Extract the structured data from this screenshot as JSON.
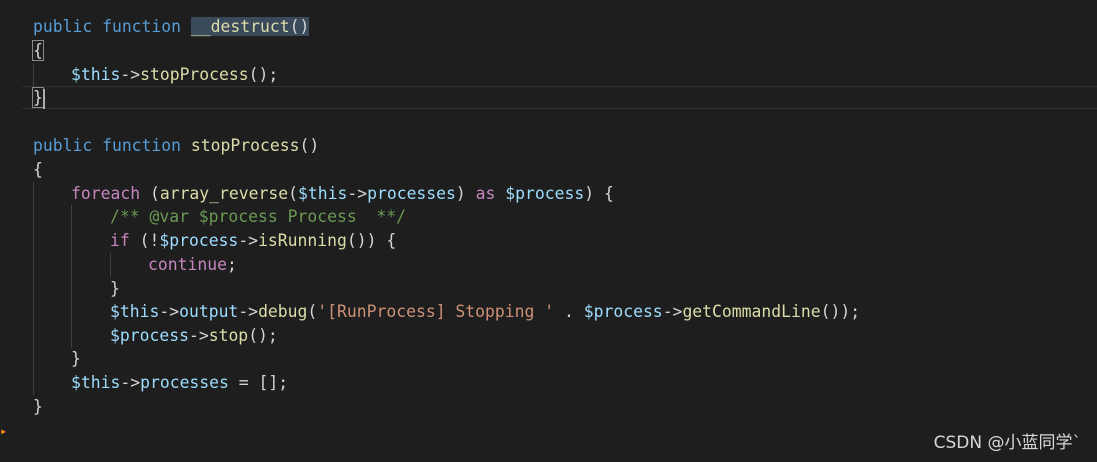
{
  "editor": {
    "language": "php",
    "lines": [
      {
        "id": "l1",
        "tokens": [
          {
            "t": "public ",
            "k": "kw"
          },
          {
            "t": "function ",
            "k": "kw"
          },
          {
            "t": "__destruct",
            "k": "fn",
            "hl": true
          },
          {
            "t": "()",
            "k": "",
            "hl": true
          }
        ]
      },
      {
        "id": "l2",
        "tokens": [
          {
            "t": "{",
            "k": "",
            "match": true
          }
        ]
      },
      {
        "id": "l3",
        "tokens": [
          {
            "t": "$this",
            "k": "var"
          },
          {
            "t": "->",
            "k": ""
          },
          {
            "t": "stopProcess",
            "k": "fn"
          },
          {
            "t": "();",
            "k": ""
          }
        ]
      },
      {
        "id": "l4",
        "tokens": [
          {
            "t": "}",
            "k": "",
            "match": true
          }
        ]
      },
      {
        "id": "l5",
        "tokens": []
      },
      {
        "id": "l6",
        "tokens": [
          {
            "t": "public ",
            "k": "kw"
          },
          {
            "t": "function ",
            "k": "kw"
          },
          {
            "t": "stopProcess",
            "k": "fn"
          },
          {
            "t": "()",
            "k": ""
          }
        ]
      },
      {
        "id": "l7",
        "tokens": [
          {
            "t": "{",
            "k": ""
          }
        ]
      },
      {
        "id": "l8",
        "tokens": [
          {
            "t": "foreach",
            "k": "kw-ctrl"
          },
          {
            "t": " (",
            "k": ""
          },
          {
            "t": "array_reverse",
            "k": "fn"
          },
          {
            "t": "(",
            "k": ""
          },
          {
            "t": "$this",
            "k": "var"
          },
          {
            "t": "->",
            "k": ""
          },
          {
            "t": "processes",
            "k": "var"
          },
          {
            "t": ") ",
            "k": ""
          },
          {
            "t": "as",
            "k": "kw-ctrl"
          },
          {
            "t": " ",
            "k": ""
          },
          {
            "t": "$process",
            "k": "var"
          },
          {
            "t": ") {",
            "k": ""
          }
        ]
      },
      {
        "id": "l9",
        "tokens": [
          {
            "t": "/** @var $process Process  **/",
            "k": "comment"
          }
        ]
      },
      {
        "id": "l10",
        "tokens": [
          {
            "t": "if",
            "k": "kw-ctrl"
          },
          {
            "t": " (!",
            "k": ""
          },
          {
            "t": "$process",
            "k": "var"
          },
          {
            "t": "->",
            "k": ""
          },
          {
            "t": "isRunning",
            "k": "fn"
          },
          {
            "t": "()) {",
            "k": ""
          }
        ]
      },
      {
        "id": "l11",
        "tokens": [
          {
            "t": "continue",
            "k": "kw-ctrl"
          },
          {
            "t": ";",
            "k": ""
          }
        ]
      },
      {
        "id": "l12",
        "tokens": [
          {
            "t": "}",
            "k": ""
          }
        ]
      },
      {
        "id": "l13",
        "tokens": [
          {
            "t": "$this",
            "k": "var"
          },
          {
            "t": "->",
            "k": ""
          },
          {
            "t": "output",
            "k": "var"
          },
          {
            "t": "->",
            "k": ""
          },
          {
            "t": "debug",
            "k": "fn"
          },
          {
            "t": "(",
            "k": ""
          },
          {
            "t": "'[RunProcess] Stopping '",
            "k": "str"
          },
          {
            "t": " . ",
            "k": ""
          },
          {
            "t": "$process",
            "k": "var"
          },
          {
            "t": "->",
            "k": ""
          },
          {
            "t": "getCommandLine",
            "k": "fn"
          },
          {
            "t": "());",
            "k": ""
          }
        ]
      },
      {
        "id": "l14",
        "tokens": [
          {
            "t": "$process",
            "k": "var"
          },
          {
            "t": "->",
            "k": ""
          },
          {
            "t": "stop",
            "k": "fn"
          },
          {
            "t": "();",
            "k": ""
          }
        ]
      },
      {
        "id": "l15",
        "tokens": [
          {
            "t": "}",
            "k": ""
          }
        ]
      },
      {
        "id": "l16",
        "tokens": [
          {
            "t": "$this",
            "k": "var"
          },
          {
            "t": "->",
            "k": ""
          },
          {
            "t": "processes",
            "k": "var"
          },
          {
            "t": " = [];",
            "k": ""
          }
        ]
      },
      {
        "id": "l17",
        "tokens": [
          {
            "t": "}",
            "k": ""
          }
        ]
      }
    ]
  },
  "colors": {
    "background": "#1e1e1e",
    "keyword": "#569cd6",
    "function": "#dcdcaa",
    "variable": "#9cdcfe",
    "control": "#c586c0",
    "string": "#ce9178",
    "comment": "#6a9955",
    "plain": "#d4d4d4"
  },
  "watermark": {
    "text": "CSDN @小蓝同学`"
  }
}
